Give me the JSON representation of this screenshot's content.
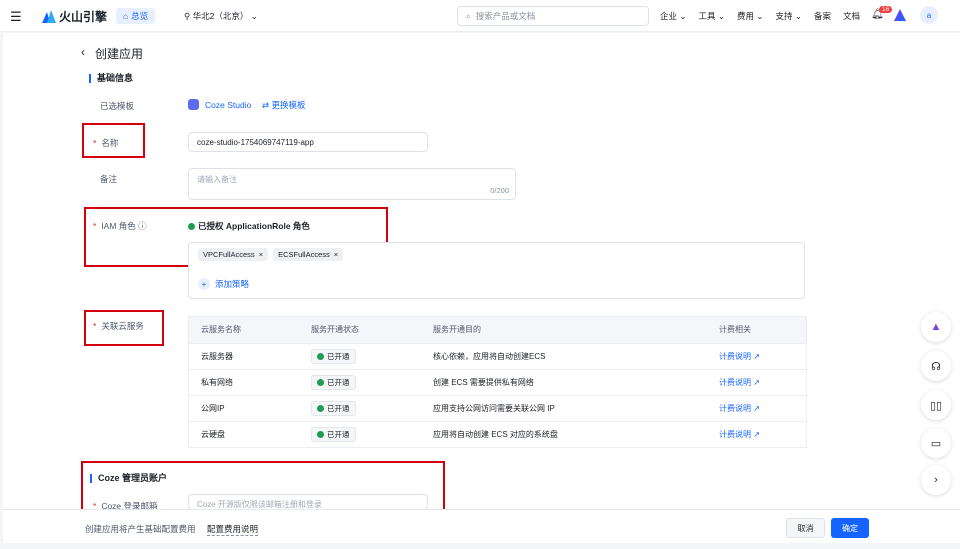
{
  "header": {
    "logo": "火山引擎",
    "overview": "总览",
    "region": "华北2（北京）",
    "search_placeholder": "搜索产品或文档",
    "nav": [
      "企业",
      "工具",
      "费用",
      "支持"
    ],
    "links": [
      "备案",
      "文档"
    ],
    "notif_count": "16",
    "avatar": "a"
  },
  "page": {
    "title": "创建应用"
  },
  "basic": {
    "section": "基础信息",
    "template_label": "已选模板",
    "template_name": "Coze Studio",
    "change_template": "更换模板",
    "name_label": "名称",
    "name_value": "coze-studio-1754069747119-app",
    "note_label": "备注",
    "note_placeholder": "请输入备注",
    "note_count": "0/200",
    "iam_label": "IAM 角色",
    "iam_status": "已授权 ApplicationRole 角色",
    "policies": [
      "VPCFullAccess",
      "ECSFullAccess"
    ],
    "add_policy": "添加策略"
  },
  "services": {
    "label": "关联云服务",
    "headers": [
      "云服务名称",
      "服务开通状态",
      "服务开通目的",
      "计费相关"
    ],
    "rows": [
      {
        "name": "云服务器",
        "status": "已开通",
        "purpose": "核心依赖，应用将自动创建ECS",
        "billing": "计费说明"
      },
      {
        "name": "私有网络",
        "status": "已开通",
        "purpose": "创建 ECS 需要提供私有网络",
        "billing": "计费说明"
      },
      {
        "name": "公网IP",
        "status": "已开通",
        "purpose": "应用支持公网访问需要关联公网 IP",
        "billing": "计费说明"
      },
      {
        "name": "云硬盘",
        "status": "已开通",
        "purpose": "应用将自动创建 ECS 对应的系统盘",
        "billing": "计费说明"
      }
    ]
  },
  "coze": {
    "section": "Coze 管理员账户",
    "email_label": "Coze 登录邮箱",
    "email_placeholder": "Coze 开源版仅限该邮箱注册和登录"
  },
  "footer": {
    "note": "创建应用将产生基础配置费用",
    "link": "配置费用说明",
    "cancel": "取消",
    "confirm": "确定"
  },
  "colors": {
    "accent": "#1664ff",
    "highlight": "#d4000e",
    "success": "#1f9d55"
  }
}
